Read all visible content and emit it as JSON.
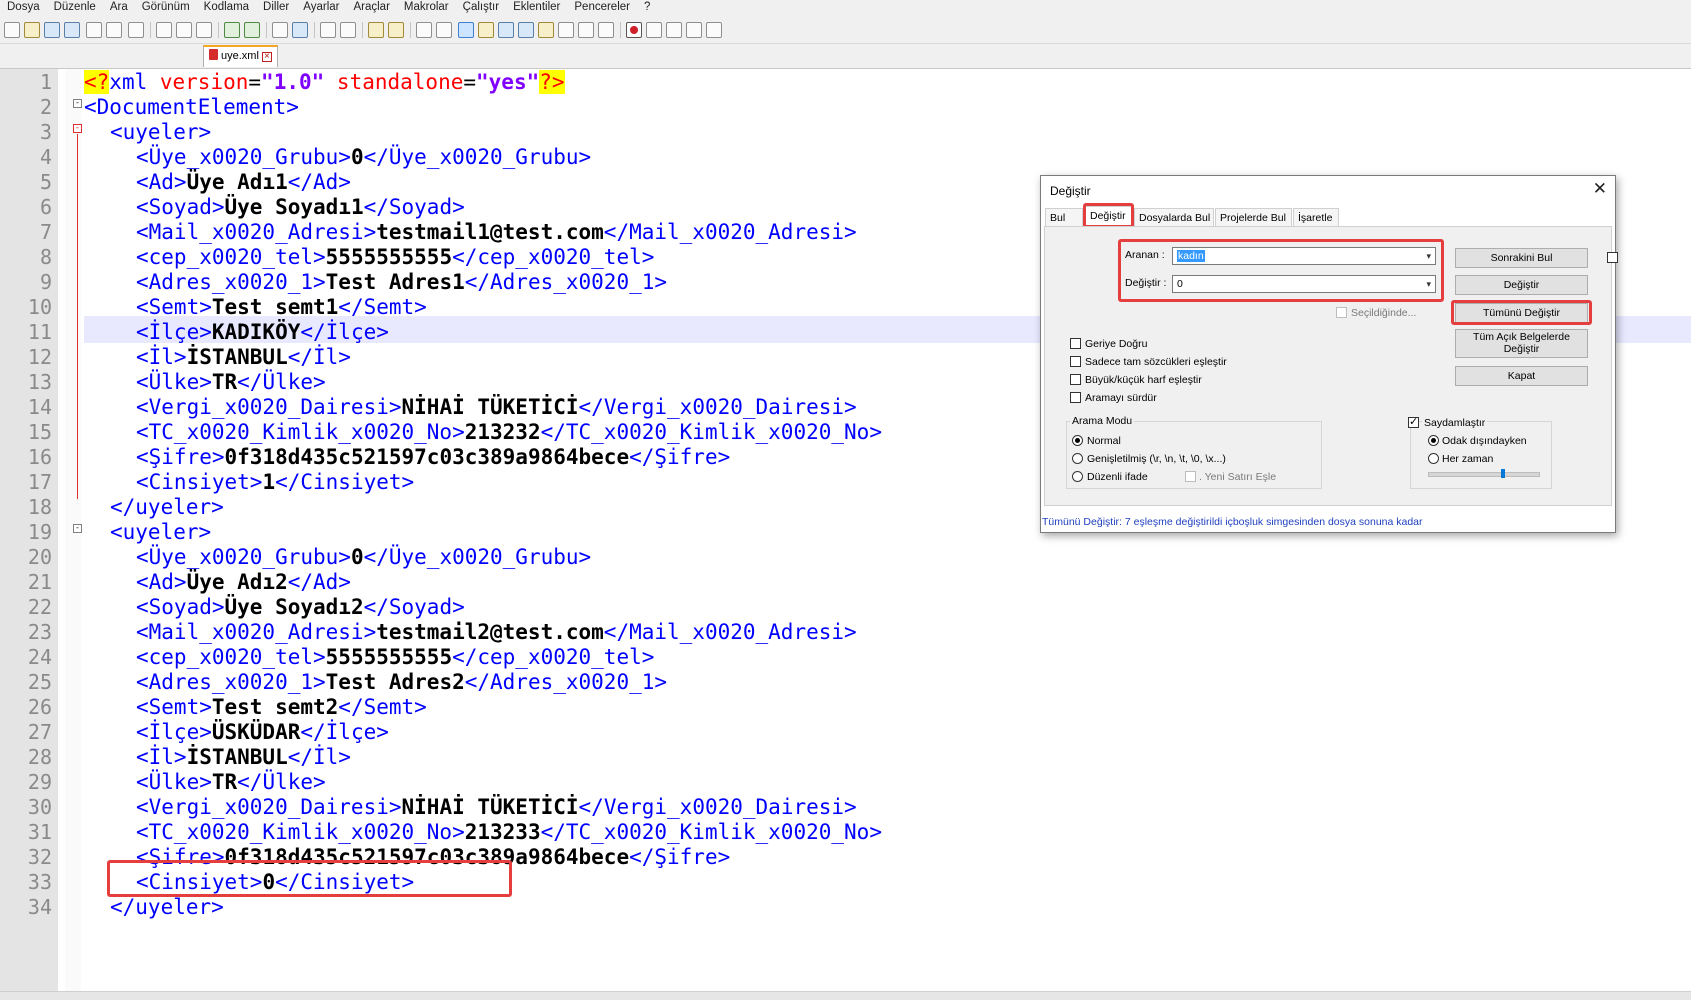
{
  "menu": [
    "Dosya",
    "Düzenle",
    "Ara",
    "Görünüm",
    "Kodlama",
    "Diller",
    "Ayarlar",
    "Araçlar",
    "Makrolar",
    "Çalıştır",
    "Eklentiler",
    "Pencereler",
    "?"
  ],
  "tab": {
    "label": "uye.xml"
  },
  "editor": {
    "line_numbers": [
      "1",
      "2",
      "3",
      "4",
      "5",
      "6",
      "7",
      "8",
      "9",
      "10",
      "11",
      "12",
      "13",
      "14",
      "15",
      "16",
      "17",
      "18",
      "19",
      "20",
      "21",
      "22",
      "23",
      "24",
      "25",
      "26",
      "27",
      "28",
      "29",
      "30",
      "31",
      "32",
      "33",
      "34"
    ],
    "line1": {
      "pi_open": "<?",
      "xml": "xml ",
      "a1": "version",
      "eq1": "=",
      "v1": "\"1.0\"",
      "sp": " ",
      "a2": "standalone",
      "eq2": "=",
      "v2": "\"yes\"",
      "pi_close": "?>"
    },
    "line2": "<DocumentElement>",
    "uyeler_open": "<uyeler>",
    "uyeler_close": "</uyeler>",
    "records": [
      {
        "grup_o": "<Üye_x0020_Grubu>",
        "grup_v": "0",
        "grup_c": "</Üye_x0020_Grubu>",
        "ad_o": "<Ad>",
        "ad_v": "Üye Adı1",
        "ad_c": "</Ad>",
        "soyad_o": "<Soyad>",
        "soyad_v": "Üye Soyadı1",
        "soyad_c": "</Soyad>",
        "mail_o": "<Mail_x0020_Adresi>",
        "mail_v": "testmail1@test.com",
        "mail_c": "</Mail_x0020_Adresi>",
        "cep_o": "<cep_x0020_tel>",
        "cep_v": "5555555555",
        "cep_c": "</cep_x0020_tel>",
        "adres_o": "<Adres_x0020_1>",
        "adres_v": "Test Adres1",
        "adres_c": "</Adres_x0020_1>",
        "semt_o": "<Semt>",
        "semt_v": "Test semt1",
        "semt_c": "</Semt>",
        "ilce_o": "<İlçe>",
        "ilce_v": "KADIKÖY",
        "ilce_c": "</İlçe>",
        "il_o": "<İl>",
        "il_v": "İSTANBUL",
        "il_c": "</İl>",
        "ulke_o": "<Ülke>",
        "ulke_v": "TR",
        "ulke_c": "</Ülke>",
        "vergi_o": "<Vergi_x0020_Dairesi>",
        "vergi_v": "NİHAİ TÜKETİCİ",
        "vergi_c": "</Vergi_x0020_Dairesi>",
        "tc_o": "<TC_x0020_Kimlik_x0020_No>",
        "tc_v": "213232",
        "tc_c": "</TC_x0020_Kimlik_x0020_No>",
        "sifre_o": "<Şifre>",
        "sifre_v": "0f318d435c521597c03c389a9864bece",
        "sifre_c": "</Şifre>",
        "cins_o": "<Cinsiyet>",
        "cins_v": "1",
        "cins_c": "</Cinsiyet>"
      },
      {
        "grup_o": "<Üye_x0020_Grubu>",
        "grup_v": "0",
        "grup_c": "</Üye_x0020_Grubu>",
        "ad_o": "<Ad>",
        "ad_v": "Üye Adı2",
        "ad_c": "</Ad>",
        "soyad_o": "<Soyad>",
        "soyad_v": "Üye Soyadı2",
        "soyad_c": "</Soyad>",
        "mail_o": "<Mail_x0020_Adresi>",
        "mail_v": "testmail2@test.com",
        "mail_c": "</Mail_x0020_Adresi>",
        "cep_o": "<cep_x0020_tel>",
        "cep_v": "5555555555",
        "cep_c": "</cep_x0020_tel>",
        "adres_o": "<Adres_x0020_1>",
        "adres_v": "Test Adres2",
        "adres_c": "</Adres_x0020_1>",
        "semt_o": "<Semt>",
        "semt_v": "Test semt2",
        "semt_c": "</Semt>",
        "ilce_o": "<İlçe>",
        "ilce_v": "ÜSKÜDAR",
        "ilce_c": "</İlçe>",
        "il_o": "<İl>",
        "il_v": "İSTANBUL",
        "il_c": "</İl>",
        "ulke_o": "<Ülke>",
        "ulke_v": "TR",
        "ulke_c": "</Ülke>",
        "vergi_o": "<Vergi_x0020_Dairesi>",
        "vergi_v": "NİHAİ TÜKETİCİ",
        "vergi_c": "</Vergi_x0020_Dairesi>",
        "tc_o": "<TC_x0020_Kimlik_x0020_No>",
        "tc_v": "213233",
        "tc_c": "</TC_x0020_Kimlik_x0020_No>",
        "sifre_o": "<Şifre>",
        "sifre_v": "0f318d435c521597c03c389a9864bece",
        "sifre_c": "</Şifre>",
        "cins_o": "<Cinsiyet>",
        "cins_v": "0",
        "cins_c": "</Cinsiyet>"
      }
    ]
  },
  "dialog": {
    "title": "Değiştir",
    "close": "✕",
    "tabs": [
      "Bul",
      "Değiştir",
      "Dosyalarda Bul",
      "Projelerde Bul",
      "İşaretle"
    ],
    "search_label": "Aranan :",
    "search_value": "kadın",
    "replace_label": "Değiştir :",
    "replace_value": "0",
    "in_selection": "Seçildiğinde...",
    "btn_find_next": "Sonrakini Bul",
    "btn_replace": "Değiştir",
    "btn_replace_all": "Tümünü Değiştir",
    "btn_replace_all_docs": "Tüm Açık Belgelerde Değiştir",
    "btn_close": "Kapat",
    "opt_backward": "Geriye Doğru",
    "opt_whole_word": "Sadece tam sözcükleri eşleştir",
    "opt_match_case": "Büyük/küçük harf eşleştir",
    "opt_wrap": "Aramayı sürdür",
    "search_mode_label": "Arama Modu",
    "mode_normal": "Normal",
    "mode_extended": "Genişletilmiş (\\r, \\n, \\t, \\0, \\x...)",
    "mode_regex": "Düzenli ifade",
    "mode_newline": ". Yeni Satırı Eşle",
    "transparency_label": "Saydamlaştır",
    "trans_on_lose_focus": "Odak dışındayken",
    "trans_always": "Her zaman",
    "status": "Tümünü Değiştir: 7 eşleşme değiştirildi içboşluk simgesinden dosya sonuna kadar"
  }
}
